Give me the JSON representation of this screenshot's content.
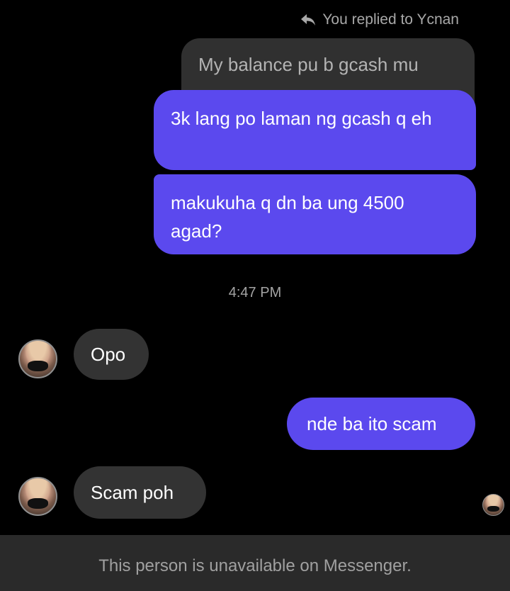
{
  "reply_header": {
    "text": "You replied to Ycnan",
    "icon": "reply-arrow-icon"
  },
  "quoted_message": {
    "text": "My balance pu b gcash mu"
  },
  "messages": [
    {
      "direction": "outgoing",
      "text": "3k lang po laman ng gcash q eh"
    },
    {
      "direction": "outgoing",
      "text": "makukuha q dn ba ung 4500 agad?"
    },
    {
      "direction": "incoming",
      "text": "Opo"
    },
    {
      "direction": "outgoing",
      "text": "nde ba ito scam"
    },
    {
      "direction": "incoming",
      "text": "Scam poh"
    }
  ],
  "timestamp": "4:47 PM",
  "footer": {
    "text": "This person is unavailable on Messenger."
  },
  "colors": {
    "background": "#000000",
    "outgoing_bubble": "#5b49ee",
    "incoming_bubble": "#333333",
    "footer_bar": "#2a2a2a"
  }
}
